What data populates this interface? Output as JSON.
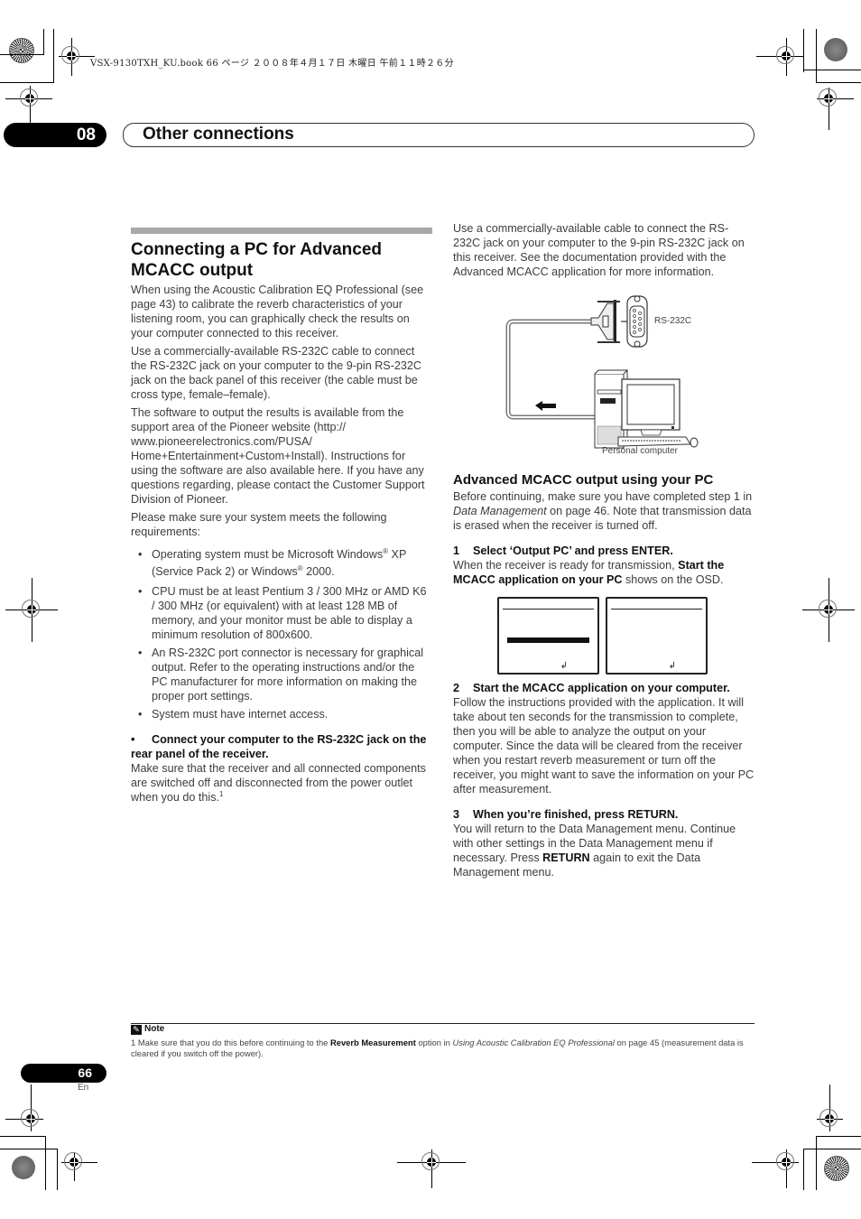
{
  "print_header": "VSX-9130TXH_KU.book  66 ページ  ２００８年４月１７日  木曜日  午前１１時２６分",
  "chapter": {
    "number": "08",
    "title": "Other connections"
  },
  "left_column": {
    "section_title": "Connecting a PC for Advanced MCACC output",
    "paragraphs": [
      "When using the Acoustic Calibration EQ Professional (see page 43) to calibrate the reverb characteristics of your listening room, you can graphically check the results on your computer connected to this receiver.",
      "Use a commercially-available RS-232C cable to connect the RS-232C jack on your computer to the 9-pin RS-232C jack on the back panel of this receiver (the cable must be cross type, female–female).",
      "The software to output the results is available from the support area of the Pioneer website (http:// www.pioneerelectronics.com/PUSA/ Home+Entertainment+Custom+Install). Instructions for using the software are also available here. If you have any questions regarding, please contact the Customer Support Division of Pioneer.",
      "Please make sure your system meets the following requirements:"
    ],
    "requirements": {
      "os_prefix": "Operating system must be Microsoft Windows",
      "os_reg": "®",
      "os_mid": " XP (Service Pack 2) or Windows",
      "os_suffix": " 2000.",
      "cpu": "CPU must be at least Pentium 3 / 300 MHz or AMD K6 / 300 MHz (or equivalent) with at least 128 MB of memory, and your monitor must be able to display a minimum resolution of 800x600.",
      "port": "An RS-232C port connector is necessary for graphical output. Refer to the operating instructions and/or the PC manufacturer for more information on making the proper port settings.",
      "internet": "System must have internet access."
    },
    "connect_heading_bullet": "•",
    "connect_heading": "Connect your computer to the RS-232C jack on the rear panel of the receiver.",
    "connect_body": "Make sure that the receiver and all connected components are switched off and disconnected from the power outlet when you do this.",
    "connect_footnote_ref": "1"
  },
  "right_column": {
    "intro": "Use a commercially-available cable to connect the RS-232C jack on your computer to the 9-pin RS-232C jack on this receiver. See the documentation provided with the Advanced MCACC application for more information.",
    "diagram": {
      "rs232c_label": "RS-232C",
      "pc_label": "Personal computer"
    },
    "subsection_title": "Advanced MCACC output using your PC",
    "before_a": "Before continuing, make sure you have completed step 1 in ",
    "before_em": "Data Management",
    "before_b": " on page 46. Note that transmission data is erased when the receiver is turned off.",
    "steps": [
      {
        "num": "1",
        "title": "Select ‘Output PC’ and press ENTER.",
        "body_a": "When the receiver is ready for transmission, ",
        "body_strong": "Start the MCACC application on your PC",
        "body_b": " shows on the OSD."
      },
      {
        "num": "2",
        "title": "Start the MCACC application on your computer.",
        "body": "Follow the instructions provided with the application. It will take about ten seconds for the transmission to complete, then you will be able to analyze the output on your computer. Since the data will be cleared from the receiver when you restart reverb measurement or turn off the receiver, you might want to save the information on your PC after measurement."
      },
      {
        "num": "3",
        "title": "When you’re finished, press RETURN.",
        "body_a": "You will return to the Data Management menu. Continue with other settings in the Data Management menu if necessary. Press ",
        "body_strong": "RETURN",
        "body_b": " again to exit the Data Management menu."
      }
    ],
    "osd_return_icon": "↲"
  },
  "note": {
    "heading": "Note",
    "icon": "✎",
    "num": "1",
    "text_a": " Make sure that you do this before continuing to the ",
    "text_strong": "Reverb Measurement",
    "text_b": " option in ",
    "text_em": "Using Acoustic Calibration EQ Professional",
    "text_c": " on page 45 (measurement data is cleared if you switch off the power)."
  },
  "footer": {
    "page_number": "66",
    "language": "En"
  }
}
